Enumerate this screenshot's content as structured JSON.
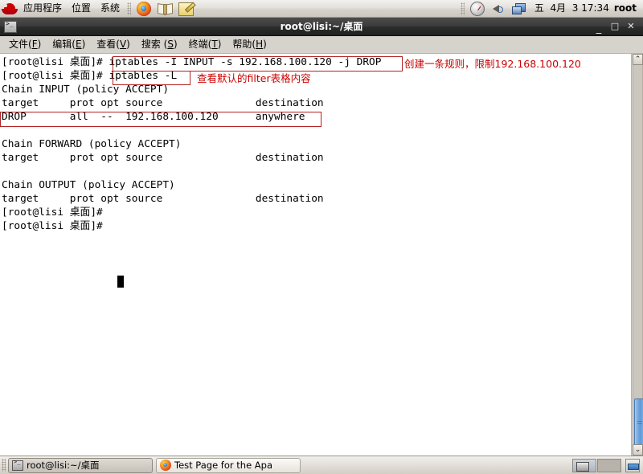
{
  "top_panel": {
    "logo_name": "red-hat-logo",
    "menus": [
      "应用程序",
      "位置",
      "系统"
    ],
    "launchers": [
      {
        "name": "firefox-icon",
        "title": "Firefox"
      },
      {
        "name": "help-book-icon",
        "title": "Help"
      },
      {
        "name": "text-editor-icon",
        "title": "Text Editor"
      }
    ],
    "tray": [
      {
        "name": "system-monitor-icon"
      },
      {
        "name": "volume-icon"
      },
      {
        "name": "network-monitor-icon"
      }
    ],
    "clock": "五  4月  3 17:34",
    "user": "root"
  },
  "window": {
    "title": "root@lisi:~/桌面",
    "icon_name": "terminal-icon",
    "buttons": {
      "minimize": "_",
      "maximize": "□",
      "close": "✕"
    },
    "menubar": [
      {
        "label": "文件(F)",
        "prefix": "文件(",
        "accel": "F",
        "suffix": ")"
      },
      {
        "label": "编辑(E)",
        "prefix": "编辑(",
        "accel": "E",
        "suffix": ")"
      },
      {
        "label": "查看(V)",
        "prefix": "查看(",
        "accel": "V",
        "suffix": ")"
      },
      {
        "label": "搜索 (S)",
        "prefix": "搜索 (",
        "accel": "S",
        "suffix": ")"
      },
      {
        "label": "终端(T)",
        "prefix": "终端(",
        "accel": "T",
        "suffix": ")"
      },
      {
        "label": "帮助(H)",
        "prefix": "帮助(",
        "accel": "H",
        "suffix": ")"
      }
    ]
  },
  "terminal": {
    "prompt": "[root@lisi 桌面]#",
    "content": "[root@lisi 桌面]# iptables -I INPUT -s 192.168.100.120 -j DROP\n[root@lisi 桌面]# iptables -L\nChain INPUT (policy ACCEPT)\ntarget     prot opt source               destination\nDROP       all  --  192.168.100.120      anywhere\n\nChain FORWARD (policy ACCEPT)\ntarget     prot opt source               destination\n\nChain OUTPUT (policy ACCEPT)\ntarget     prot opt source               destination\n[root@lisi 桌面]#\n[root@lisi 桌面]# ",
    "commands": [
      "iptables -I INPUT -s 192.168.100.120 -j DROP",
      "iptables -L"
    ],
    "rule_row": {
      "target": "DROP",
      "prot": "all",
      "opt": "--",
      "source": "192.168.100.120",
      "destination": "anywhere"
    },
    "chains": [
      {
        "name": "Chain INPUT (policy ACCEPT)"
      },
      {
        "name": "Chain FORWARD (policy ACCEPT)"
      },
      {
        "name": "Chain OUTPUT (policy ACCEPT)"
      }
    ],
    "table_header": "target     prot opt source               destination",
    "cursor": "block"
  },
  "annotations": {
    "color": "#cc0000",
    "note_create_rule": "创建一条规则，限制192.168.100.120",
    "note_view_filter": "查看默认的filter表格内容"
  },
  "scrollbar": {
    "up_arrow": "⌃",
    "down_arrow": "⌄"
  },
  "bottom_panel": {
    "tasks": [
      {
        "label": "root@lisi:~/桌面",
        "icon": "terminal-icon",
        "active": true
      },
      {
        "label": "Test Page for the Apa",
        "icon": "firefox-icon",
        "active": false
      }
    ],
    "workspaces": [
      {
        "name": "workspace-1",
        "active": true
      },
      {
        "name": "workspace-2",
        "active": false
      }
    ],
    "show_desktop_name": "show-desktop-button"
  }
}
